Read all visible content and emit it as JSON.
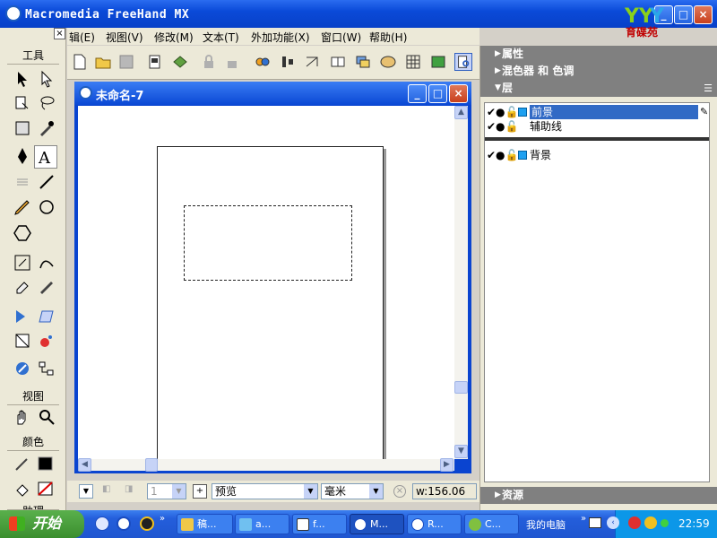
{
  "window": {
    "title": "Macromedia FreeHand MX",
    "minimize": "_",
    "maximize": "□",
    "close": "×"
  },
  "brand": {
    "text": "育碟苑"
  },
  "menu": [
    {
      "label": "编辑(E)",
      "shown": "辑(E)"
    },
    {
      "label": "视图(V)",
      "shown": "视图(V)"
    },
    {
      "label": "修改(M)",
      "shown": "修改(M)"
    },
    {
      "label": "文本(T)",
      "shown": "文本(T)"
    },
    {
      "label": "外加功能(X)",
      "shown": "外加功能(X)"
    },
    {
      "label": "窗口(W)",
      "shown": "窗口(W)"
    },
    {
      "label": "帮助(H)",
      "shown": "帮助(H)"
    }
  ],
  "tools": {
    "title": "工具",
    "view_title": "视图",
    "color_title": "颜色",
    "assist_title": "助理"
  },
  "document": {
    "title": "未命名-7"
  },
  "status": {
    "view_mode": "预览",
    "unit": "毫米",
    "width_readout": "w:156.06",
    "page_num": "1"
  },
  "right_panel": {
    "properties": "属性",
    "mixer": "混色器 和 色调",
    "layers": "层",
    "assets": "资源",
    "layer_items": [
      {
        "name": "前景",
        "selected": true,
        "color": "#1ea0f0"
      },
      {
        "name": "辅助线",
        "selected": false
      },
      {
        "name": "背景",
        "selected": false,
        "color": "#1ea0f0"
      }
    ]
  },
  "taskbar": {
    "start": "开始",
    "tasks": [
      "稿...",
      "a...",
      "f...",
      "M...",
      "R...",
      "C..."
    ],
    "my_computer": "我的电脑",
    "clock": "22:59"
  }
}
